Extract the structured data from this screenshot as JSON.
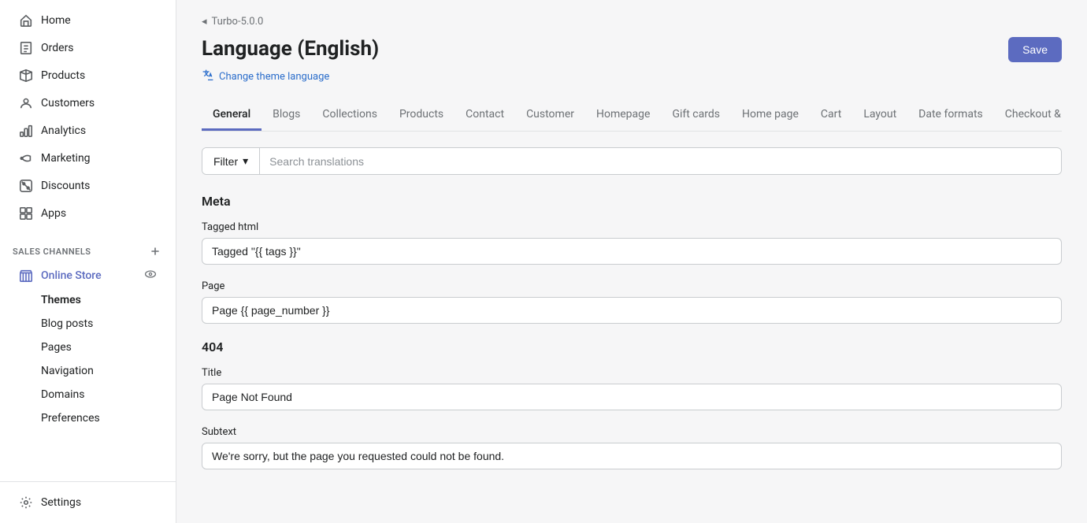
{
  "sidebar": {
    "nav_items": [
      {
        "id": "home",
        "label": "Home",
        "icon": "home"
      },
      {
        "id": "orders",
        "label": "Orders",
        "icon": "orders"
      },
      {
        "id": "products",
        "label": "Products",
        "icon": "products"
      },
      {
        "id": "customers",
        "label": "Customers",
        "icon": "customers"
      },
      {
        "id": "analytics",
        "label": "Analytics",
        "icon": "analytics"
      },
      {
        "id": "marketing",
        "label": "Marketing",
        "icon": "marketing"
      },
      {
        "id": "discounts",
        "label": "Discounts",
        "icon": "discounts"
      },
      {
        "id": "apps",
        "label": "Apps",
        "icon": "apps"
      }
    ],
    "sales_channels_label": "Sales Channels",
    "online_store_label": "Online Store",
    "sub_nav": [
      {
        "id": "themes",
        "label": "Themes",
        "active": true
      },
      {
        "id": "blog-posts",
        "label": "Blog posts"
      },
      {
        "id": "pages",
        "label": "Pages"
      },
      {
        "id": "navigation",
        "label": "Navigation"
      },
      {
        "id": "domains",
        "label": "Domains"
      },
      {
        "id": "preferences",
        "label": "Preferences"
      }
    ],
    "settings_label": "Settings"
  },
  "breadcrumb": {
    "icon": "◂",
    "text": "Turbo-5.0.0"
  },
  "header": {
    "title": "Language (English)",
    "save_label": "Save"
  },
  "change_language": {
    "text": "Change theme language"
  },
  "tabs": [
    {
      "id": "general",
      "label": "General",
      "active": true
    },
    {
      "id": "blogs",
      "label": "Blogs"
    },
    {
      "id": "collections",
      "label": "Collections"
    },
    {
      "id": "products",
      "label": "Products"
    },
    {
      "id": "contact",
      "label": "Contact"
    },
    {
      "id": "customer",
      "label": "Customer"
    },
    {
      "id": "homepage",
      "label": "Homepage"
    },
    {
      "id": "gift-cards",
      "label": "Gift cards"
    },
    {
      "id": "home-page",
      "label": "Home page"
    },
    {
      "id": "cart",
      "label": "Cart"
    },
    {
      "id": "layout",
      "label": "Layout"
    },
    {
      "id": "date-formats",
      "label": "Date formats"
    },
    {
      "id": "checkout",
      "label": "Checkout & system"
    }
  ],
  "filter": {
    "label": "Filter",
    "search_placeholder": "Search translations"
  },
  "meta_section": {
    "title": "Meta",
    "fields": [
      {
        "id": "tagged_html",
        "label": "Tagged html",
        "value": "Tagged \"{{ tags }}\""
      },
      {
        "id": "page",
        "label": "Page",
        "value": "Page {{ page_number }}"
      }
    ]
  },
  "section_404": {
    "title": "404",
    "fields": [
      {
        "id": "title",
        "label": "Title",
        "value": "Page Not Found"
      },
      {
        "id": "subtext",
        "label": "Subtext",
        "value": "We're sorry, but the page you requested could not be found."
      }
    ]
  },
  "colors": {
    "accent": "#5c6bc0"
  }
}
